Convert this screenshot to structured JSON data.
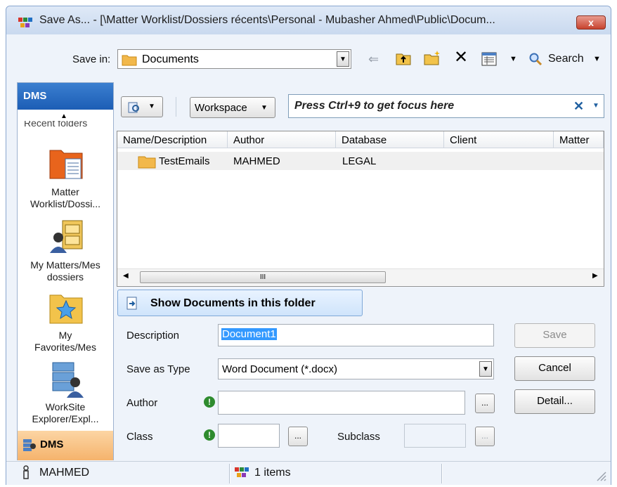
{
  "window": {
    "title": "Save As... - [\\Matter Worklist/Dossiers récents\\Personal - Mubasher Ahmed\\Public\\Docum...",
    "close_label": "x"
  },
  "toolbar": {
    "save_in_label": "Save in:",
    "save_in_value": "Documents",
    "search_label": "Search"
  },
  "search_bar": {
    "scope_label": "Workspace",
    "placeholder_text": "Press Ctrl+9 to get focus here",
    "clear_label": "✕"
  },
  "sidebar": {
    "header": "DMS",
    "clipped_text": "Recent folders",
    "items": [
      {
        "label": "Matter Worklist/Dossi...",
        "icon": "matter-worklist-icon"
      },
      {
        "label": "My Matters/Mes dossiers",
        "icon": "my-matters-icon"
      },
      {
        "label": "My Favorites/Mes",
        "icon": "my-favorites-icon"
      },
      {
        "label": "WorkSite Explorer/Expl...",
        "icon": "worksite-explorer-icon"
      }
    ],
    "footer": "DMS"
  },
  "grid": {
    "columns": [
      "Name/Description",
      "Author",
      "Database",
      "Client",
      "Matter"
    ],
    "rows": [
      {
        "name": "TestEmails",
        "author": "MAHMED",
        "database": "LEGAL",
        "client": "",
        "matter": ""
      }
    ],
    "scroll_thumb_label": "III"
  },
  "show_docs_button": "Show Documents in this folder",
  "form": {
    "description_label": "Description",
    "description_value": "Document1",
    "save_as_type_label": "Save as Type",
    "save_as_type_value": "Word Document (*.docx)",
    "author_label": "Author",
    "author_value": "",
    "class_label": "Class",
    "class_value": "",
    "subclass_label": "Subclass",
    "subclass_value": "",
    "browse_label": "..."
  },
  "buttons": {
    "save": "Save",
    "cancel": "Cancel",
    "detail": "Detail..."
  },
  "statusbar": {
    "user": "MAHMED",
    "items": "1 items"
  },
  "colors": {
    "accent": "#1c5db5",
    "required": "#2e8b2e",
    "footer": "#f5b36c",
    "selection": "#3399ff"
  }
}
